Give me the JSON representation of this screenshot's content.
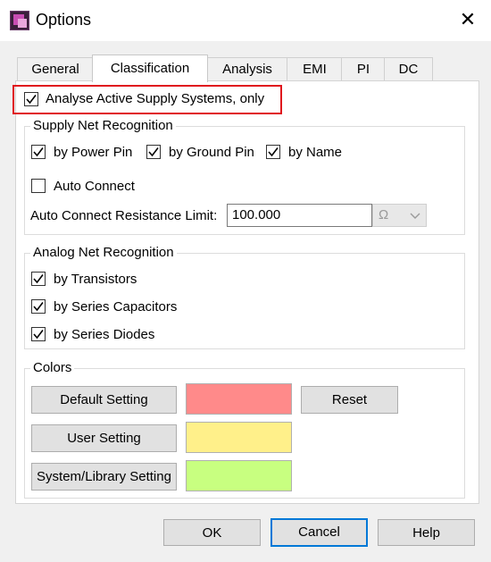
{
  "window": {
    "title": "Options",
    "close_glyph": "✕"
  },
  "tabs": [
    {
      "label": "General",
      "active": false
    },
    {
      "label": "Classification",
      "active": true
    },
    {
      "label": "Analysis",
      "active": false
    },
    {
      "label": "EMI",
      "active": false
    },
    {
      "label": "PI",
      "active": false
    },
    {
      "label": "DC",
      "active": false
    }
  ],
  "analyse_active": {
    "label": "Analyse Active Supply Systems, only",
    "checked": true
  },
  "supply_net": {
    "title": "Supply Net Recognition",
    "by_power_pin": {
      "label": "by Power Pin",
      "checked": true
    },
    "by_ground_pin": {
      "label": "by Ground Pin",
      "checked": true
    },
    "by_name": {
      "label": "by Name",
      "checked": true
    },
    "auto_connect": {
      "label": "Auto Connect",
      "checked": false
    },
    "resistance_label": "Auto Connect Resistance Limit:",
    "resistance_value": "100.000",
    "unit": "Ω"
  },
  "analog_net": {
    "title": "Analog Net Recognition",
    "by_transistors": {
      "label": "by Transistors",
      "checked": true
    },
    "by_series_capacitors": {
      "label": "by Series Capacitors",
      "checked": true
    },
    "by_series_diodes": {
      "label": "by Series Diodes",
      "checked": true
    }
  },
  "colors": {
    "title": "Colors",
    "default_setting": {
      "label": "Default Setting",
      "color": "#ff8a8a"
    },
    "user_setting": {
      "label": "User Setting",
      "color": "#fff08a"
    },
    "system_library_setting": {
      "label": "System/Library Setting",
      "color": "#c8ff80"
    },
    "reset_label": "Reset"
  },
  "footer": {
    "ok": "OK",
    "cancel": "Cancel",
    "help": "Help"
  },
  "accent": {
    "highlight": "#e0141d",
    "focus": "#0078d7"
  }
}
